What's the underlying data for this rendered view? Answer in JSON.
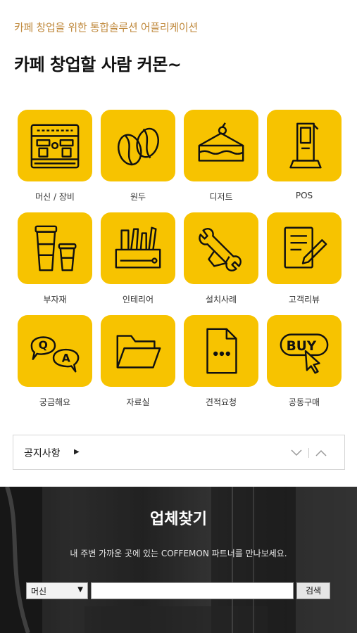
{
  "header": {
    "subtitle": "카페 창업을 위한 통합솔루션 어플리케이션",
    "headline": "카페 창업할 사람 커몬~"
  },
  "categories": [
    {
      "label": "머신 / 장비",
      "icon": "espresso-machine-icon"
    },
    {
      "label": "원두",
      "icon": "coffee-beans-icon"
    },
    {
      "label": "디저트",
      "icon": "cake-icon"
    },
    {
      "label": "POS",
      "icon": "kiosk-icon"
    },
    {
      "label": "부자재",
      "icon": "takeout-cups-icon"
    },
    {
      "label": "인테리어",
      "icon": "tools-box-icon"
    },
    {
      "label": "설치사례",
      "icon": "wrench-hand-icon"
    },
    {
      "label": "고객리뷰",
      "icon": "review-pen-icon"
    },
    {
      "label": "궁금해요",
      "icon": "qa-bubbles-icon"
    },
    {
      "label": "자료실",
      "icon": "folder-icon"
    },
    {
      "label": "견적요청",
      "icon": "document-icon"
    },
    {
      "label": "공동구매",
      "icon": "buy-click-icon"
    }
  ],
  "notice": {
    "title": "공지사항",
    "caret": "▶"
  },
  "finder": {
    "title": "업체찾기",
    "description": "내 주변 가까운 곳에 있는 COFFEMON 파트너를 만나보세요.",
    "select_value": "머신",
    "search_value": "",
    "search_button": "검색"
  },
  "colors": {
    "accent": "#f7c300",
    "subtitle": "#c08a3e"
  }
}
